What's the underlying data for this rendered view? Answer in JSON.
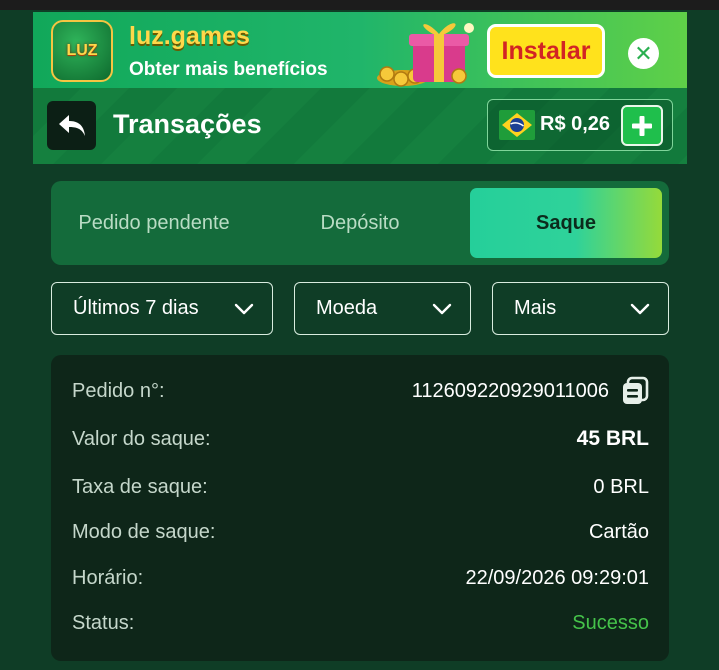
{
  "promo": {
    "logo_text": "LUZ",
    "name": "luz.games",
    "subtitle": "Obter mais benefícios",
    "install_label": "Instalar",
    "close_glyph": "✕"
  },
  "header": {
    "title": "Transações",
    "balance": "R$ 0,26"
  },
  "tabs": [
    {
      "label": "Pedido pendente",
      "active": false
    },
    {
      "label": "Depósito",
      "active": false
    },
    {
      "label": "Saque",
      "active": true
    }
  ],
  "filters": [
    {
      "label": "Últimos 7 dias"
    },
    {
      "label": "Moeda"
    },
    {
      "label": "Mais"
    }
  ],
  "transaction": {
    "order_label": "Pedido n°:",
    "order_value": "112609220929011006",
    "amount_label": "Valor do saque:",
    "amount_value": "45 BRL",
    "fee_label": "Taxa de saque:",
    "fee_value": "0 BRL",
    "mode_label": "Modo de saque:",
    "mode_value": "Cartão",
    "time_label": "Horário:",
    "time_value": "22/09/2026 09:29:01",
    "status_label": "Status:",
    "status_value": "Sucesso"
  },
  "colors": {
    "background": "#0f3d26",
    "accent_green": "#1fbf4c",
    "install_yellow": "#ffe21c",
    "success": "#45c34a"
  },
  "icons": [
    "back-arrow-icon",
    "brazil-flag-icon",
    "plus-icon",
    "close-icon",
    "chevron-down-icon",
    "copy-icon",
    "gift-box-icon"
  ]
}
